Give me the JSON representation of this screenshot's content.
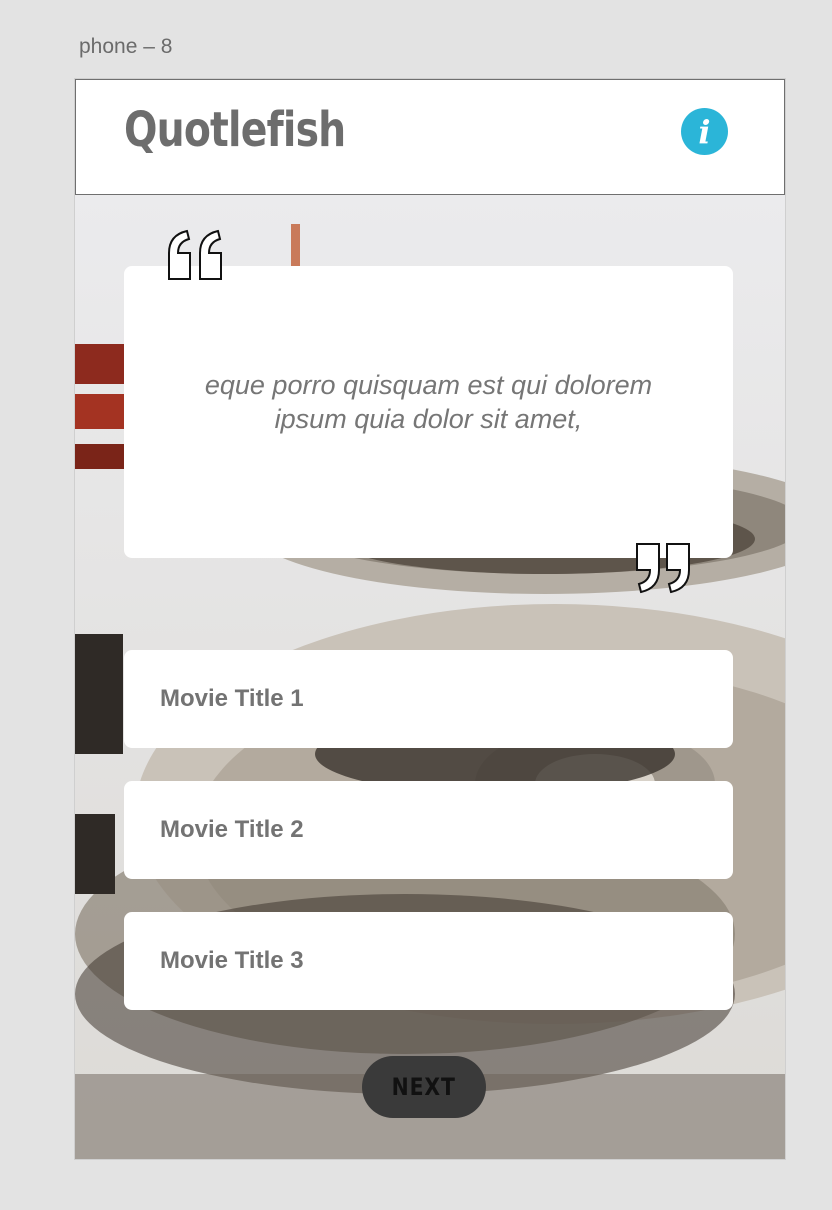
{
  "artboard": {
    "label": "phone – 8"
  },
  "header": {
    "logo": "Quotlefish",
    "info_icon": "info-icon",
    "info_glyph": "i"
  },
  "quote": {
    "text": "eque porro quisquam est qui dolorem ipsum quia dolor sit amet,",
    "open_icon": "open-quote-icon",
    "close_icon": "close-quote-icon"
  },
  "options": [
    {
      "label": "Movie Title 1"
    },
    {
      "label": "Movie Title 2"
    },
    {
      "label": "Movie Title 3"
    }
  ],
  "next_button": {
    "label": "NEXT"
  },
  "colors": {
    "accent": "#2bb5d8",
    "logo": "#6d6d6d",
    "button_dark": "#3a3a3a",
    "card": "#ffffff"
  }
}
